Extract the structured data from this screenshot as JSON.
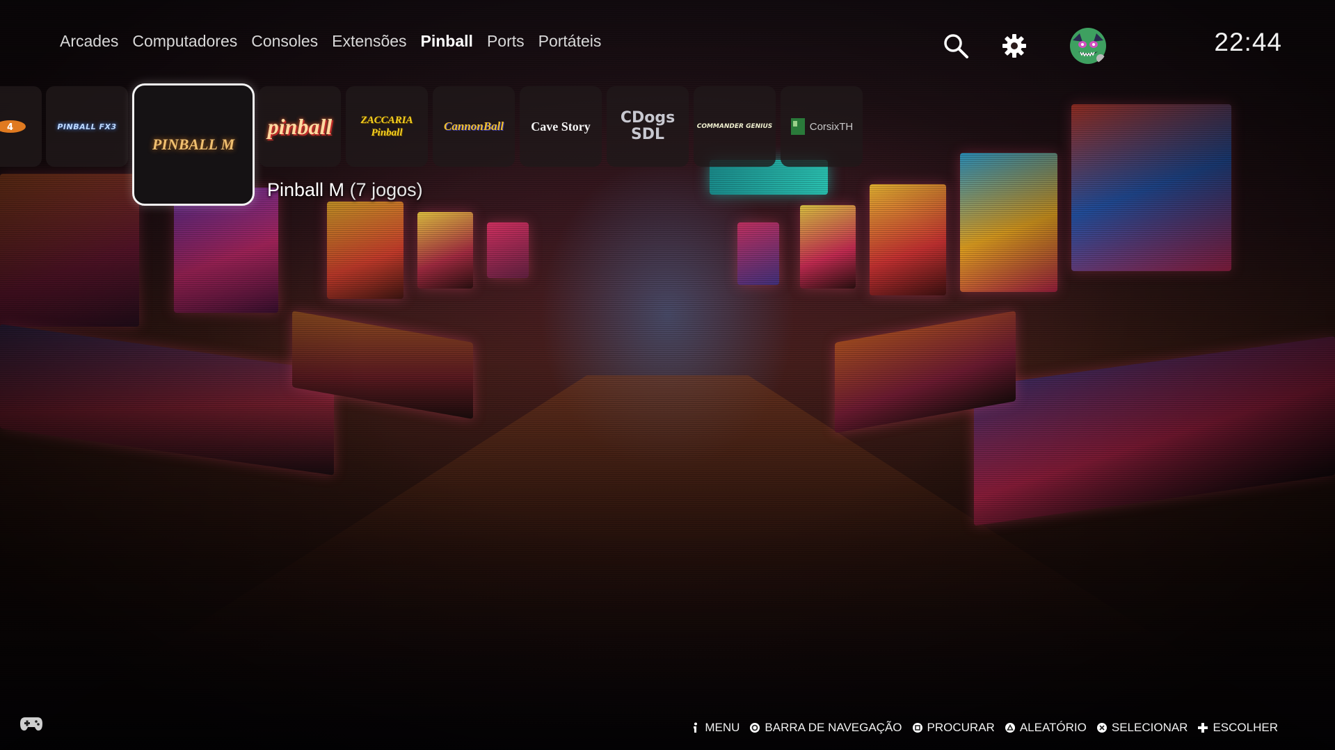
{
  "nav": {
    "items": [
      {
        "label": "Arcades"
      },
      {
        "label": "Computadores"
      },
      {
        "label": "Consoles"
      },
      {
        "label": "Extensões"
      },
      {
        "label": "Pinball"
      },
      {
        "label": "Ports"
      },
      {
        "label": "Portáteis"
      }
    ],
    "active_index": 4
  },
  "top_icons": {
    "search": "search-icon",
    "settings": "gear-icon",
    "avatar": "avatar-icon"
  },
  "clock": "22:44",
  "systems": [
    {
      "label": "",
      "icon": "pinball-logo-icon"
    },
    {
      "label": "PINBALL FX3",
      "icon": "pinball-fx3-logo-icon"
    },
    {
      "label": "PINBALL M",
      "icon": "pinball-m-logo-icon"
    },
    {
      "label": "pinball",
      "icon": "future-pinball-logo-icon"
    },
    {
      "label": "ZACCARIA Pinball",
      "icon": "zaccaria-pinball-logo-icon"
    },
    {
      "label": "CannonBall",
      "icon": "cannonball-logo-icon"
    },
    {
      "label": "Cave Story",
      "icon": "cave-story-logo-icon"
    },
    {
      "label": "CDogs SDL",
      "icon": "cdogs-logo-icon"
    },
    {
      "label": "COMMANDER GENIUS",
      "icon": "commander-genius-logo-icon"
    },
    {
      "label": "CorsixTH",
      "icon": "corsixth-logo-icon"
    }
  ],
  "selected": {
    "name": "Pinball M",
    "count": "(7 jogos)"
  },
  "help": [
    {
      "glyph": "info-icon",
      "label": "MENU"
    },
    {
      "glyph": "circle-button-icon",
      "label": "BARRA DE NAVEGAÇÃO"
    },
    {
      "glyph": "square-button-icon",
      "label": "PROCURAR"
    },
    {
      "glyph": "triangle-button-icon",
      "label": "ALEATÓRIO"
    },
    {
      "glyph": "cross-button-icon",
      "label": "SELECIONAR"
    },
    {
      "glyph": "dpad-icon",
      "label": "ESCOLHER"
    }
  ],
  "colors": {
    "active_nav": "#ffffff",
    "inactive_nav": "#d8d8d8",
    "selected_border": "#f4f4f4",
    "tile_bg": "#20181a"
  }
}
